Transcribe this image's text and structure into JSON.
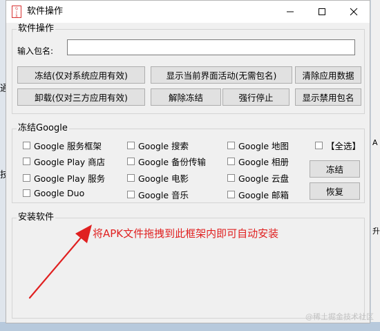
{
  "window": {
    "title": "软件操作",
    "icon_text": "GJX"
  },
  "software_ops": {
    "legend": "软件操作",
    "package_label": "输入包名:",
    "package_value": "",
    "buttons": {
      "freeze": "冻结(仅对系统应用有效)",
      "show_activity": "显示当前界面活动(无需包名)",
      "clear_data": "清除应用数据",
      "uninstall": "卸载(仅对三方应用有效)",
      "unfreeze": "解除冻结",
      "force_stop": "强行停止",
      "show_disabled": "显示禁用包名"
    }
  },
  "freeze_google": {
    "legend": "冻结Google",
    "checkboxes": [
      {
        "label": "Google 服务框架",
        "checked": false
      },
      {
        "label": "Google 搜索",
        "checked": false
      },
      {
        "label": "Google 地图",
        "checked": false
      },
      {
        "label": "Google Play 商店",
        "checked": false
      },
      {
        "label": "Google 备份传输",
        "checked": false
      },
      {
        "label": "Google 相册",
        "checked": false
      },
      {
        "label": "Google Play 服务",
        "checked": false
      },
      {
        "label": "Google 电影",
        "checked": false
      },
      {
        "label": "Google 云盘",
        "checked": false
      },
      {
        "label": "Google Duo",
        "checked": false
      },
      {
        "label": "Google 音乐",
        "checked": false
      },
      {
        "label": "Google 邮箱",
        "checked": false
      }
    ],
    "select_all": "【全选】",
    "freeze_button": "冻结",
    "restore_button": "恢复"
  },
  "install": {
    "legend": "安装软件",
    "hint": "将APK文件拖拽到此框架内即可自动安装"
  },
  "background": {
    "watermark": "@稀土掘金技术社区",
    "peeks": [
      "通",
      "A",
      "技",
      "打",
      "升"
    ]
  },
  "colors": {
    "hint": "#e02020",
    "window_bg": "#f0f0f0",
    "titlebar_bg": "#ffffff",
    "desktop": "#c9d6e3"
  }
}
